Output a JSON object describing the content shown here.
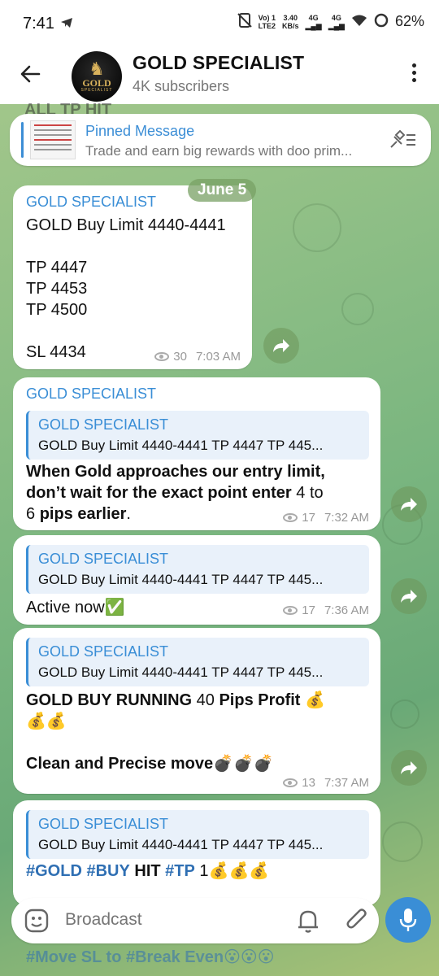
{
  "status_bar": {
    "time": "7:41",
    "network_1_top": "Vo) 1",
    "network_1_bottom": "LTE2",
    "speed_top": "3.40",
    "speed_bottom": "KB/s",
    "net_a": "4G",
    "net_b": "4G",
    "battery": "62%"
  },
  "header": {
    "title": "GOLD SPECIALIST",
    "subtitle": "4K subscribers",
    "avatar_line1": "GOLD",
    "avatar_line2": "SPECIALIST"
  },
  "top_partial_text": "ALL TP HIT",
  "pinned": {
    "title": "Pinned Message",
    "text": "Trade and earn big rewards with doo prim..."
  },
  "date_chip": "June 5",
  "messages": [
    {
      "sender": "GOLD SPECIALIST",
      "body": "GOLD Buy Limit 4440-4441\n\nTP 4447\nTP 4453\nTP 4500\n\nSL 4434",
      "views": "30",
      "time": "7:03 AM"
    },
    {
      "sender": "GOLD SPECIALIST",
      "reply_sender": "GOLD SPECIALIST",
      "reply_text": "GOLD Buy Limit 4440-4441  TP 4447 TP 445...",
      "body_line1_bold": "When Gold approaches our entry limit,",
      "body_line2_bold": "don’t wait for the exact point enter",
      "body_line2_plain": " 4 to",
      "body_line3_plain": "6 ",
      "body_line3_bold": "pips earlier",
      "body_line3_end": ".",
      "views": "17",
      "time": "7:32 AM"
    },
    {
      "reply_sender": "GOLD SPECIALIST",
      "reply_text": "GOLD Buy Limit 4440-4441  TP 4447 TP 445...",
      "body": "Active now✅",
      "views": "17",
      "time": "7:36 AM"
    },
    {
      "reply_sender": "GOLD SPECIALIST",
      "reply_text": "GOLD Buy Limit 4440-4441  TP 4447 TP 445...",
      "line1_bold": "GOLD BUY RUNNING",
      "line1_plain": " 40 ",
      "line1_bold2": "Pips Profit",
      "line1_emoji": " 💰",
      "line2_emoji": "💰💰",
      "line3_bold": "Clean and Precise move",
      "line3_emoji": "💣💣💣",
      "views": "13",
      "time": "7:37 AM"
    },
    {
      "reply_sender": "GOLD SPECIALIST",
      "reply_text": "GOLD Buy Limit 4440-4441  TP 4447 TP 445...",
      "tag1": "#GOLD",
      "tag2": "#BUY",
      "word": "HIT",
      "tag3": "#TP",
      "tail": " 1💰💰💰"
    }
  ],
  "bottom_partial_text": "#Move SL to #Break Even😮😮😮",
  "input": {
    "placeholder": "Broadcast"
  },
  "colors": {
    "accent": "#3a8ed6",
    "hashtag": "#2f6fb3",
    "bg_green": "#79b57f"
  }
}
